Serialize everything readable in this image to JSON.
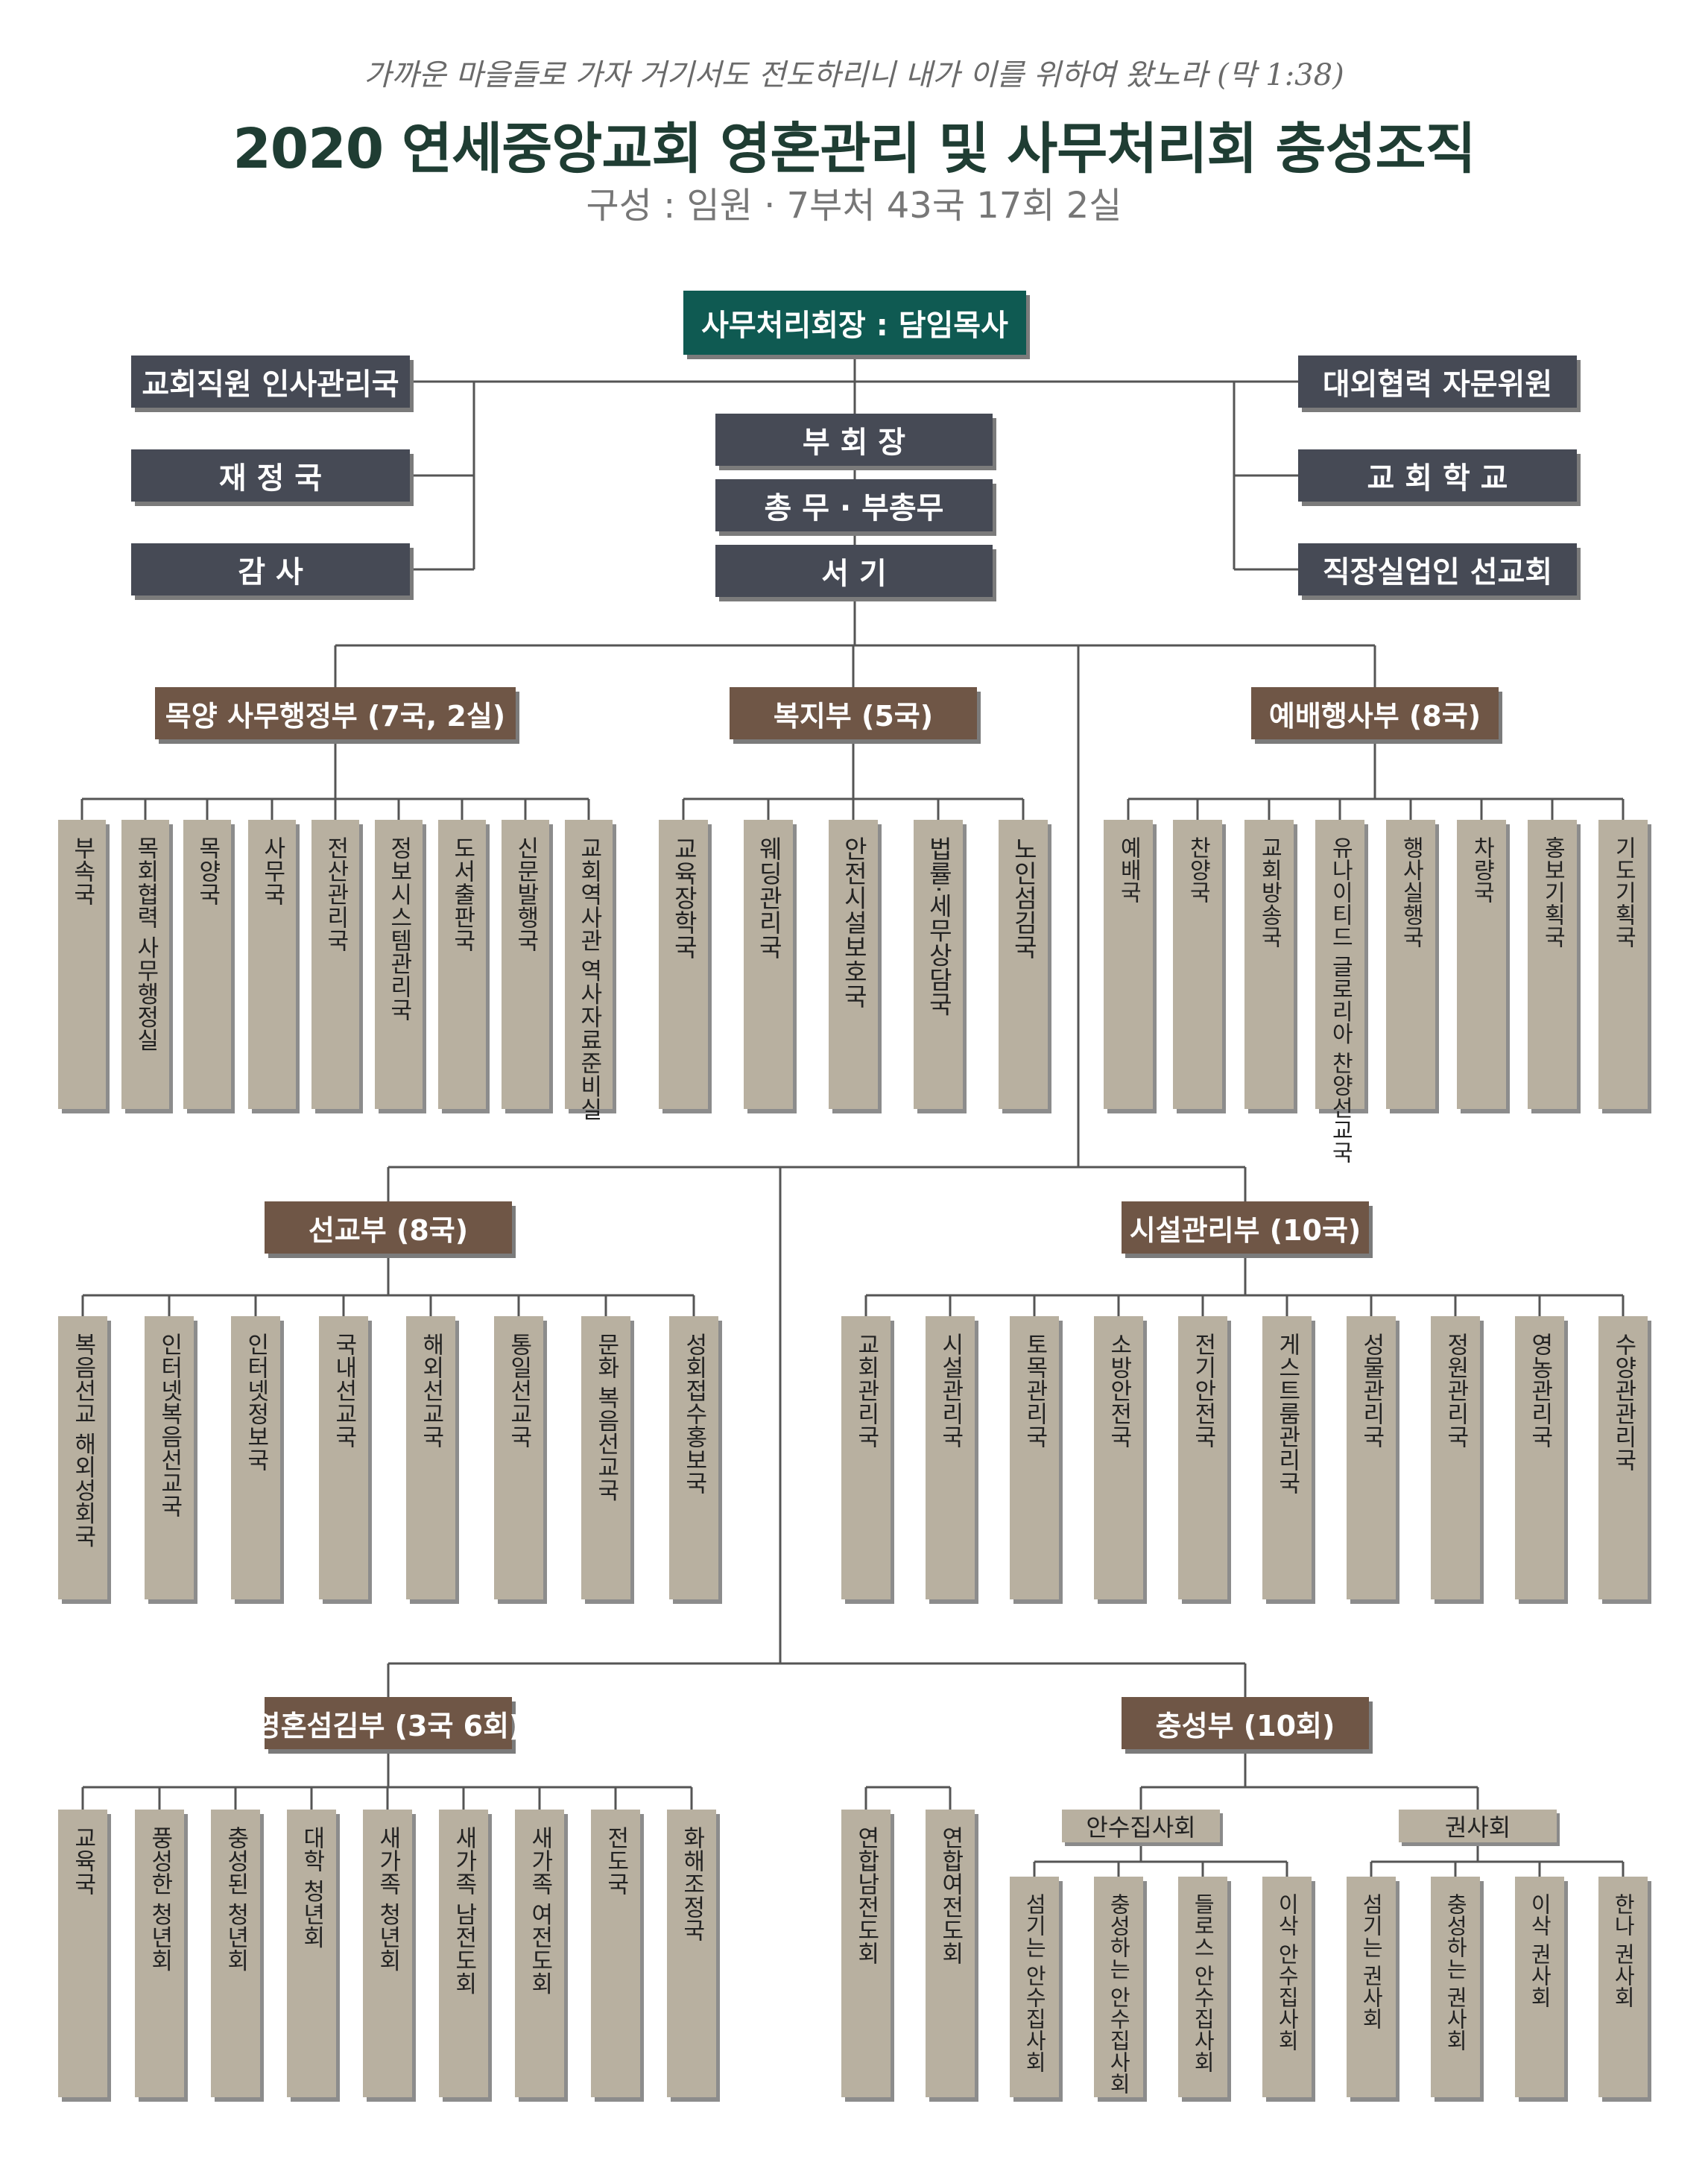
{
  "header": {
    "verse": "가까운 마을들로 가자 거기서도 전도하리니 내가 이를 위하여 왔노라 (막 1:38)",
    "title": "2020 연세중앙교회 영혼관리 및 사무처리회 충성조직",
    "subtitle": "구성 : 임원 · 7부처 43국 17회 2실"
  },
  "top": {
    "chair": "사무처리회장 : 담임목사",
    "vice": "부 회 장",
    "general": "총 무 · 부총무",
    "secretary": "서 기"
  },
  "left_offices": [
    "교회직원 인사관리국",
    "재 정 국",
    "감 사"
  ],
  "right_offices": [
    "대외협력 자문위원",
    "교 회 학 교",
    "직장실업인 선교회"
  ],
  "departments": {
    "mokyang": {
      "label": "목양 사무행정부 (7국, 2실)",
      "items": [
        "부속국",
        "목회협력 사무행정실",
        "목양국",
        "사무국",
        "전산관리국",
        "정보시스템관리국",
        "도서출판국",
        "신문발행국",
        "교회역사관 역사자료준비실"
      ]
    },
    "bokji": {
      "label": "복지부 (5국)",
      "items": [
        "교육장학국",
        "웨딩관리국",
        "안전시설보호국",
        "법률·세무상담국",
        "노인섬김국"
      ]
    },
    "yebae": {
      "label": "예배행사부 (8국)",
      "items": [
        "예배국",
        "찬양국",
        "교회방송국",
        "유나이티드 글로리아 찬양선교국",
        "행사실행국",
        "차량국",
        "홍보기획국",
        "기도기획국"
      ]
    },
    "seongyo": {
      "label": "선교부 (8국)",
      "items": [
        "복음선교 해외성회국",
        "인터넷복음선교국",
        "인터넷정보국",
        "국내선교국",
        "해외선교국",
        "통일선교국",
        "문화 복음선교국",
        "성회접수홍보국"
      ]
    },
    "siseol": {
      "label": "시설관리부 (10국)",
      "items": [
        "교회관리국",
        "시설관리국",
        "토목관리국",
        "소방안전국",
        "전기안전국",
        "게스트룸관리국",
        "성물관리국",
        "정원관리국",
        "영농관리국",
        "수양관관리국"
      ]
    },
    "yeonghon": {
      "label": "영혼섬김부 (3국 6회)",
      "items": [
        "교육국",
        "풍성한 청년회",
        "충성된 청년회",
        "대학 청년회",
        "새가족 청년회",
        "새가족 남전도회",
        "새가족 여전도회",
        "전도국",
        "화해조정국"
      ]
    },
    "chungseong": {
      "label": "충성부 (10회)",
      "items": [
        "연합남전도회",
        "연합여전도회"
      ],
      "ansu": {
        "label": "안수집사회",
        "items": [
          "섬기는 안수집사회",
          "충성하는 안수집사회",
          "들로스 안수집사회",
          "이삭 안수집사회"
        ]
      },
      "gwonsa": {
        "label": "권사회",
        "items": [
          "섬기는 권사회",
          "충성하는 권사회",
          "이삭 권사회",
          "한나 권사회"
        ]
      }
    }
  }
}
